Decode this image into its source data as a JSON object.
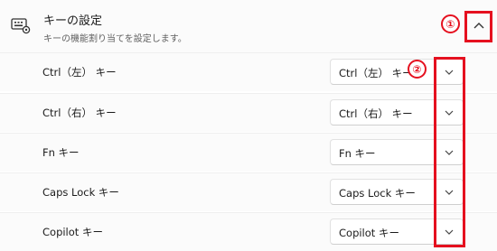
{
  "header": {
    "title": "キーの設定",
    "description": "キーの機能割り当てを設定します。",
    "icon": "keyboard-gear-icon",
    "collapse_icon": "chevron-up-icon"
  },
  "annotations": {
    "marker1": "①",
    "marker2": "②",
    "color": "#e5101f"
  },
  "rows": [
    {
      "label": "Ctrl（左） キー",
      "value": "Ctrl（左） キー"
    },
    {
      "label": "Ctrl（右） キー",
      "value": "Ctrl（右） キー"
    },
    {
      "label": "Fn キー",
      "value": "Fn キー"
    },
    {
      "label": "Caps Lock キー",
      "value": "Caps Lock キー"
    },
    {
      "label": "Copilot キー",
      "value": "Copilot キー"
    }
  ]
}
